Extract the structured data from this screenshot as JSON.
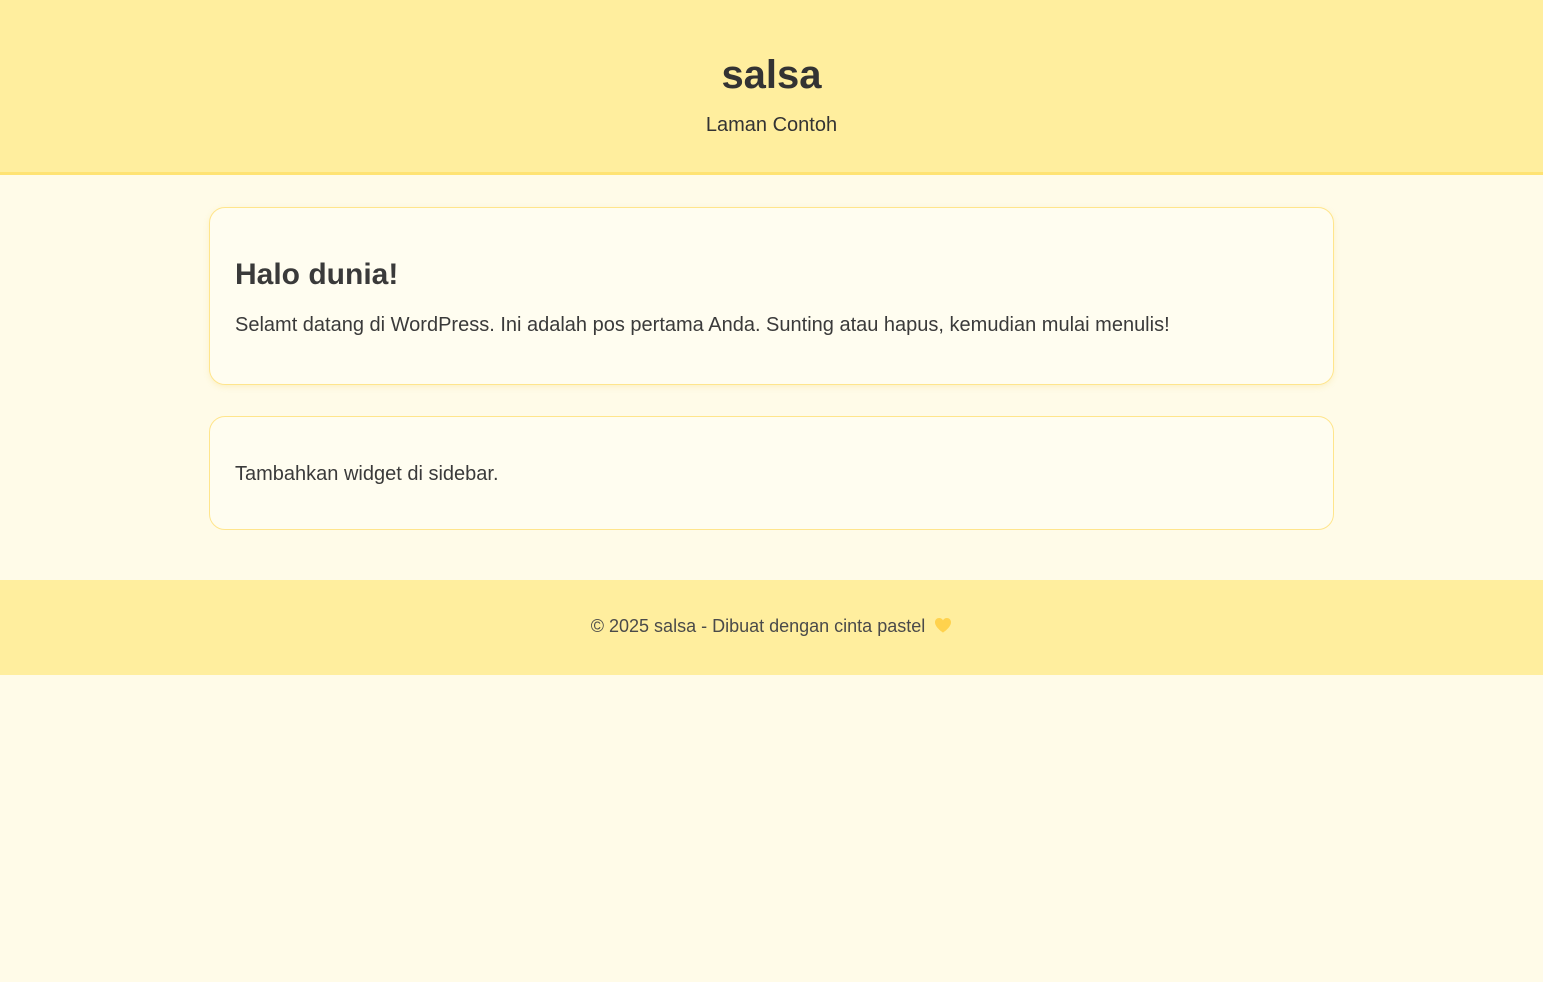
{
  "header": {
    "site_title": "salsa",
    "nav_link": "Laman Contoh"
  },
  "post": {
    "title": "Halo dunia!",
    "excerpt": "Selamt datang di WordPress. Ini adalah pos pertama Anda. Sunting atau hapus, kemudian mulai menulis!"
  },
  "sidebar": {
    "widget_text": "Tambahkan widget di sidebar."
  },
  "footer": {
    "text": "© 2025 salsa - Dibuat dengan cinta pastel",
    "icon": "yellow-heart-icon"
  },
  "colors": {
    "header_bg": "#ffee9e",
    "page_bg": "#fffbe8",
    "card_bg": "#fffdf0",
    "card_border": "#ffe58c",
    "heart": "#ffd24d"
  }
}
